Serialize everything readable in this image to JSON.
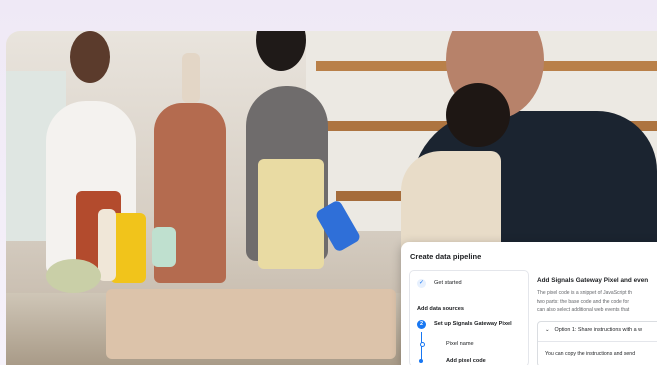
{
  "photo": {
    "description_icon": "photo-scene-icon"
  },
  "panel": {
    "title": "Create data pipeline",
    "sidebar": {
      "step_get_started": "Get started",
      "section_add_sources": "Add data sources",
      "step_number": "2",
      "step_setup": "Set up Signals Gateway Pixel",
      "substep_pixel_name": "Pixel name",
      "substep_add_code": "Add pixel code"
    },
    "main": {
      "title": "Add Signals Gateway Pixel and even",
      "desc_line1": "The pixel code is a snippet of JavaScript th",
      "desc_line2": "two parts: the base code and the code for",
      "desc_line3": "can also select additional web events that",
      "option1_label": "Option 1: Share instructions with a w",
      "option1_sub": "You can copy the instructions and send"
    }
  },
  "colors": {
    "accent": "#1877f2",
    "panel_bg": "#ffffff",
    "page_bg": "#efe9f6"
  }
}
